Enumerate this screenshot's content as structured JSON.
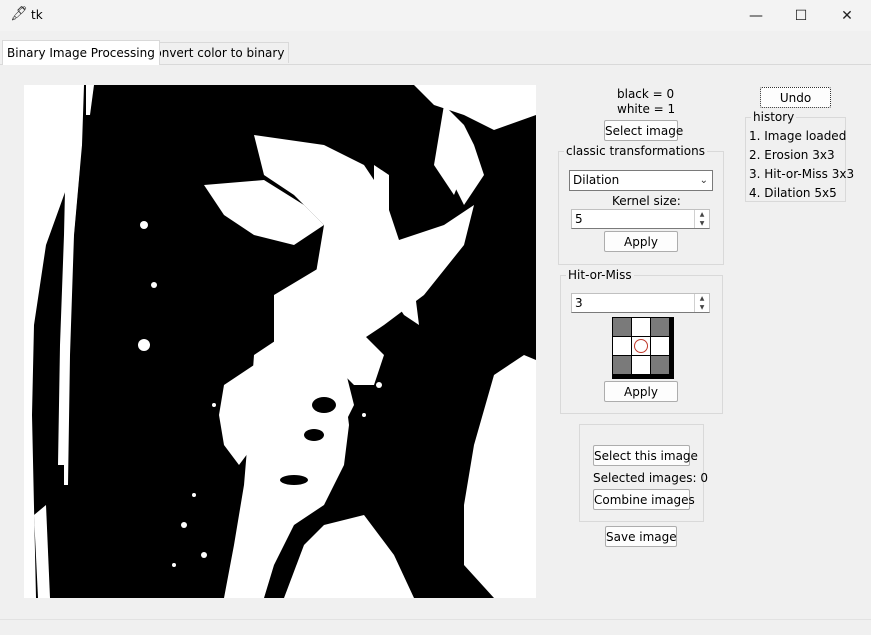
{
  "window": {
    "title": "tk",
    "icon": "feather-icon"
  },
  "tabs": [
    {
      "label": "Binary Image Processing",
      "active": true
    },
    {
      "label": "Convert color to binary",
      "active": false
    }
  ],
  "legend": {
    "black": "black = 0",
    "white": "white = 1"
  },
  "select_image_label": "Select image",
  "classic": {
    "title": "classic transformations",
    "operation": "Dilation",
    "kernel_label": "Kernel size:",
    "kernel_value": "5",
    "apply_label": "Apply"
  },
  "hitmiss": {
    "title": "Hit-or-Miss",
    "size_value": "3",
    "pattern": [
      "dark",
      "light",
      "dark",
      "light",
      "center",
      "light",
      "dark",
      "light",
      "dark"
    ],
    "apply_label": "Apply"
  },
  "combine": {
    "select_this_label": "Select this image",
    "selected_count": "Selected images: 0",
    "combine_label": "Combine images"
  },
  "save_label": "Save image",
  "undo_label": "Undo",
  "history": {
    "title": "history",
    "items": [
      "1. Image loaded",
      "2. Erosion 3x3",
      "3. Hit-or-Miss 3x3",
      "4. Dilation 5x5"
    ]
  },
  "colors": {
    "background": "#f0f0f0",
    "image_black": "#000000",
    "image_white": "#ffffff",
    "center_marker": "#c0392b"
  }
}
